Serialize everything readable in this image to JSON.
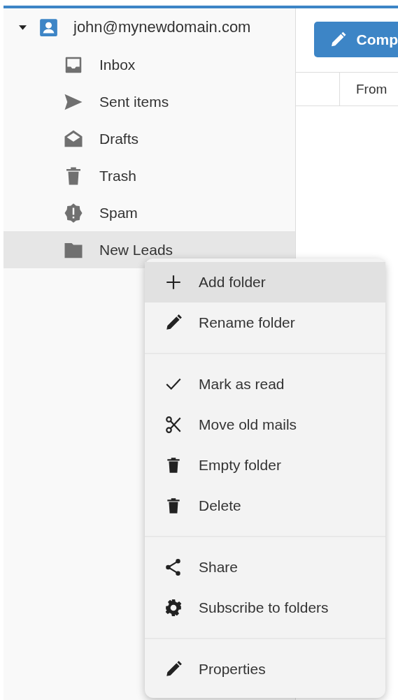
{
  "account": {
    "name": "john@mynewdomain.com",
    "expanded": true
  },
  "folders": [
    {
      "label": "Inbox",
      "kind": "inbox",
      "selected": false
    },
    {
      "label": "Sent items",
      "kind": "sent",
      "selected": false
    },
    {
      "label": "Drafts",
      "kind": "drafts",
      "selected": false
    },
    {
      "label": "Trash",
      "kind": "trash",
      "selected": false
    },
    {
      "label": "Spam",
      "kind": "spam",
      "selected": false
    },
    {
      "label": "New Leads",
      "kind": "folder",
      "selected": true
    }
  ],
  "compose_button": {
    "label": "Comp"
  },
  "message_list": {
    "columns": [
      "From"
    ]
  },
  "context_menu": {
    "groups": [
      [
        {
          "label": "Add folder",
          "kind": "add",
          "selected": true
        },
        {
          "label": "Rename folder",
          "kind": "pencil",
          "selected": false
        }
      ],
      [
        {
          "label": "Mark as read",
          "kind": "check",
          "selected": false
        },
        {
          "label": "Move old mails",
          "kind": "scissors",
          "selected": false
        },
        {
          "label": "Empty folder",
          "kind": "trash",
          "selected": false
        },
        {
          "label": "Delete",
          "kind": "trash",
          "selected": false
        }
      ],
      [
        {
          "label": "Share",
          "kind": "share",
          "selected": false
        },
        {
          "label": "Subscribe to folders",
          "kind": "gear",
          "selected": false
        }
      ],
      [
        {
          "label": "Properties",
          "kind": "pencil",
          "selected": false
        }
      ]
    ]
  }
}
